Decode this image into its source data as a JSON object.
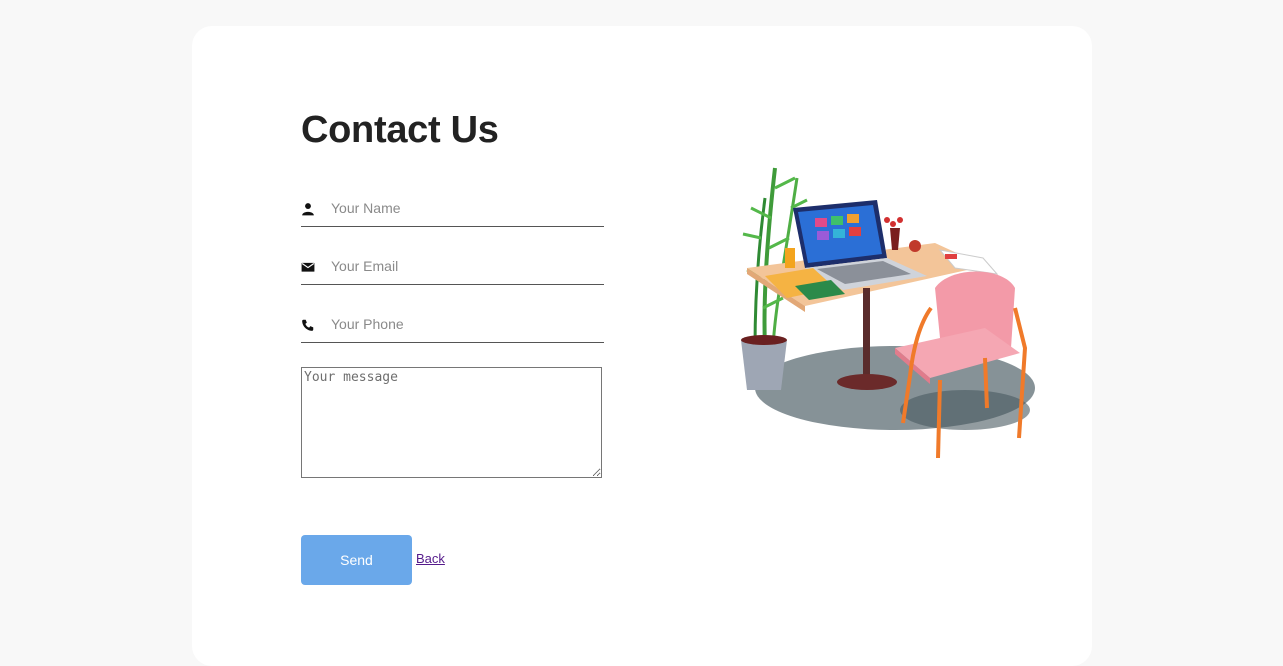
{
  "form": {
    "title": "Contact Us",
    "name_placeholder": "Your Name",
    "email_placeholder": "Your Email",
    "phone_placeholder": "Your Phone",
    "message_placeholder": "Your message",
    "send_label": "Send",
    "back_label": "Back"
  },
  "icons": {
    "name": "person-icon",
    "email": "email-icon",
    "phone": "phone-icon"
  },
  "colors": {
    "send_button": "#6aa8ea",
    "link_visited": "#551a8b",
    "page_background": "#f8f8f8",
    "card_background": "#ffffff"
  }
}
